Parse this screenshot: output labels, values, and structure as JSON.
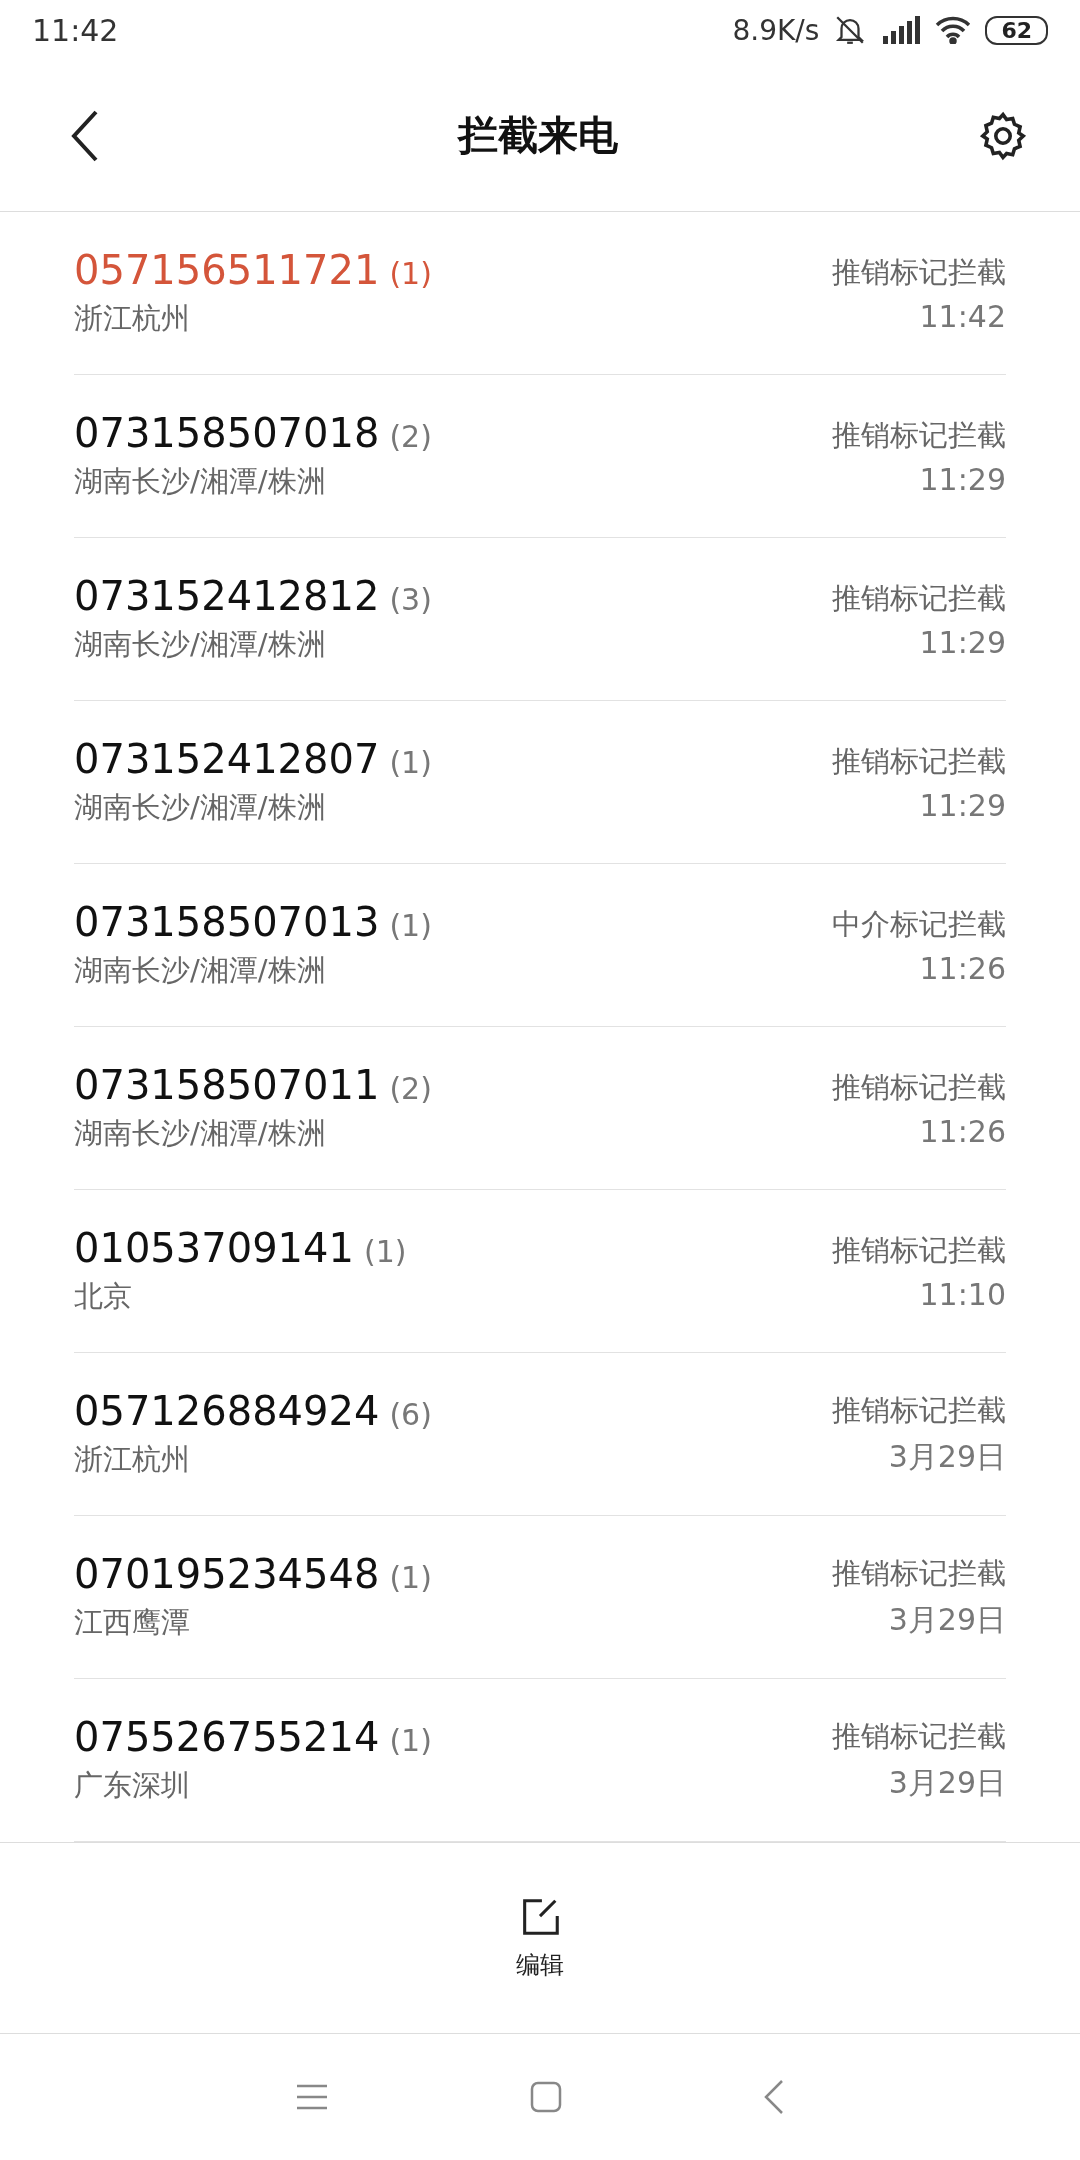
{
  "status_bar": {
    "time": "11:42",
    "speed": "8.9K/s",
    "battery": "62"
  },
  "header": {
    "title": "拦截来电"
  },
  "calls": [
    {
      "number": "057156511721",
      "count": "(1)",
      "location": "浙江杭州",
      "reason": "推销标记拦截",
      "time": "11:42",
      "unread": true
    },
    {
      "number": "073158507018",
      "count": "(2)",
      "location": "湖南长沙/湘潭/株洲",
      "reason": "推销标记拦截",
      "time": "11:29",
      "unread": false
    },
    {
      "number": "073152412812",
      "count": "(3)",
      "location": "湖南长沙/湘潭/株洲",
      "reason": "推销标记拦截",
      "time": "11:29",
      "unread": false
    },
    {
      "number": "073152412807",
      "count": "(1)",
      "location": "湖南长沙/湘潭/株洲",
      "reason": "推销标记拦截",
      "time": "11:29",
      "unread": false
    },
    {
      "number": "073158507013",
      "count": "(1)",
      "location": "湖南长沙/湘潭/株洲",
      "reason": "中介标记拦截",
      "time": "11:26",
      "unread": false
    },
    {
      "number": "073158507011",
      "count": "(2)",
      "location": "湖南长沙/湘潭/株洲",
      "reason": "推销标记拦截",
      "time": "11:26",
      "unread": false
    },
    {
      "number": "01053709141",
      "count": "(1)",
      "location": "北京",
      "reason": "推销标记拦截",
      "time": "11:10",
      "unread": false
    },
    {
      "number": "057126884924",
      "count": "(6)",
      "location": "浙江杭州",
      "reason": "推销标记拦截",
      "time": "3月29日",
      "unread": false
    },
    {
      "number": "070195234548",
      "count": "(1)",
      "location": "江西鹰潭",
      "reason": "推销标记拦截",
      "time": "3月29日",
      "unread": false
    },
    {
      "number": "075526755214",
      "count": "(1)",
      "location": "广东深圳",
      "reason": "推销标记拦截",
      "time": "3月29日",
      "unread": false
    }
  ],
  "toolbar": {
    "edit_label": "编辑"
  }
}
